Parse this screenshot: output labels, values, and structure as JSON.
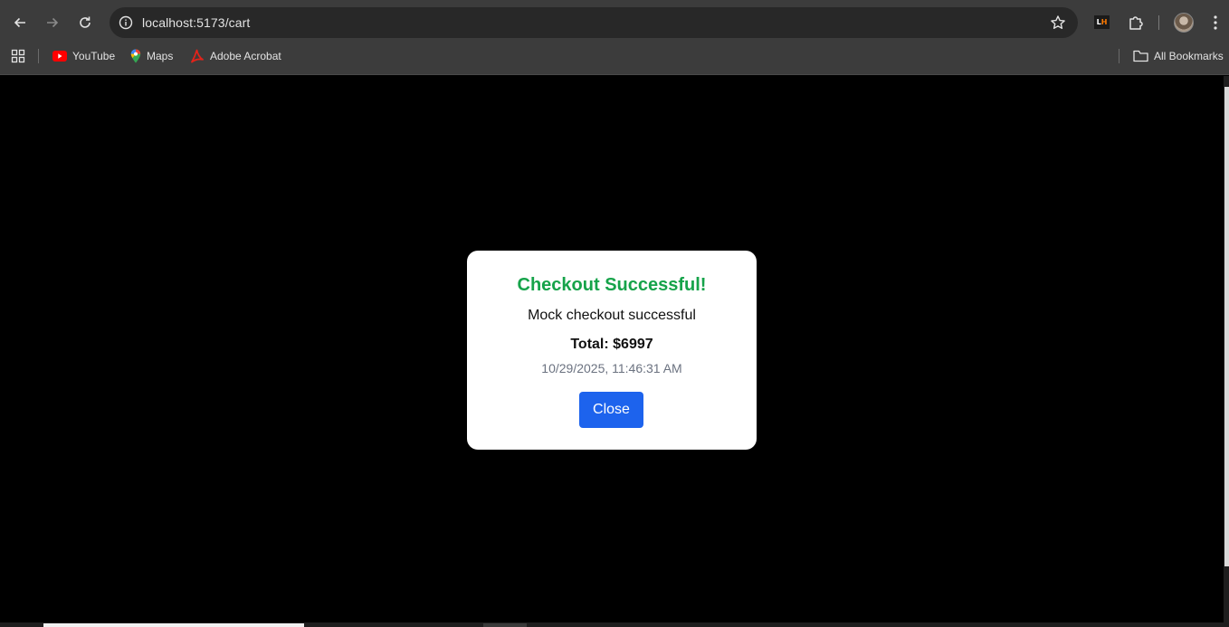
{
  "browser": {
    "url": "localhost:5173/cart",
    "bookmarks": [
      {
        "label": "YouTube",
        "icon": "youtube-icon"
      },
      {
        "label": "Maps",
        "icon": "maps-icon"
      },
      {
        "label": "Adobe Acrobat",
        "icon": "acrobat-icon"
      }
    ],
    "all_bookmarks_label": "All Bookmarks",
    "extension_badge": {
      "l": "L",
      "h": "H"
    }
  },
  "modal": {
    "title": "Checkout Successful!",
    "message": "Mock checkout successful",
    "total": "Total: $6997",
    "timestamp": "10/29/2025, 11:46:31 AM",
    "close_label": "Close"
  },
  "colors": {
    "title_green": "#16a34a",
    "button_blue": "#1d63ed",
    "youtube_red": "#ff0000",
    "acrobat_red": "#e2231a"
  }
}
